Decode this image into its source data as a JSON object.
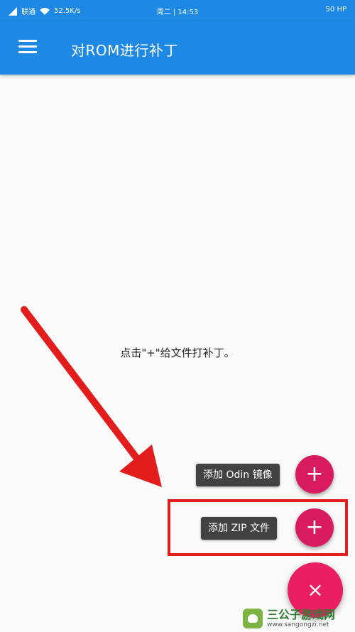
{
  "status_bar": {
    "carrier": "联通",
    "speed": "52.5K/s",
    "time": "周二 | 14:53",
    "battery": "50 HP"
  },
  "app_bar": {
    "title": "对ROM进行补丁",
    "menu_icon": "menu-icon"
  },
  "content": {
    "empty_hint": "点击\"+\"给文件打补丁。"
  },
  "fab_menu": {
    "items": [
      {
        "label": "添加 Odin 镜像",
        "icon": "plus-icon",
        "glyph": "+"
      },
      {
        "label": "添加 ZIP 文件",
        "icon": "plus-icon",
        "glyph": "+"
      }
    ],
    "main_icon": "close-icon",
    "main_glyph": "×"
  },
  "watermark": {
    "title": "三公子游戏网",
    "url": "www.sangongzi.net"
  },
  "colors": {
    "primary": "#1e88e5",
    "accent": "#e91e63",
    "annotation_red": "#e31c1c"
  }
}
